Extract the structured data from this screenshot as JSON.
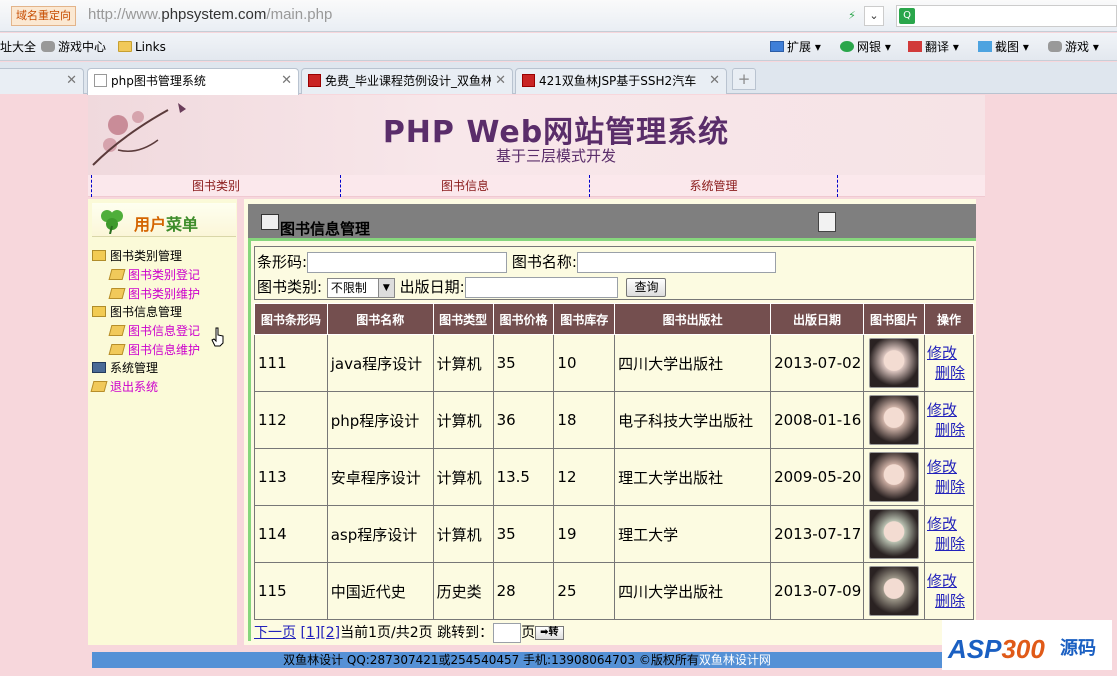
{
  "browser": {
    "redirect_badge": "域名重定向",
    "url_prefix": "http://www.",
    "url_host": "phpsystem.com",
    "url_path": "/main.php"
  },
  "bookmarks": {
    "left": [
      {
        "label": "址大全"
      },
      {
        "label": "游戏中心"
      },
      {
        "label": "Links"
      }
    ],
    "right": [
      {
        "label": "扩展"
      },
      {
        "label": "网银"
      },
      {
        "label": "翻译"
      },
      {
        "label": "截图"
      },
      {
        "label": "游戏"
      }
    ]
  },
  "tabs": [
    {
      "label": "php图书管理系统",
      "active": true
    },
    {
      "label": "免费_毕业课程范例设计_双鱼林",
      "active": false
    },
    {
      "label": "421双鱼林JSP基于SSH2汽车",
      "active": false
    }
  ],
  "banner": {
    "title": "PHP Web网站管理系统",
    "subtitle": "基于三层模式开发"
  },
  "nav": [
    "图书类别",
    "图书信息",
    "系统管理"
  ],
  "sidebar": {
    "title_a": "用户",
    "title_b": "菜单",
    "items": [
      {
        "label": "图书类别管理",
        "type": "folder"
      },
      {
        "label": "图书类别登记",
        "type": "link"
      },
      {
        "label": "图书类别维护",
        "type": "link"
      },
      {
        "label": "图书信息管理",
        "type": "folder"
      },
      {
        "label": "图书信息登记",
        "type": "link"
      },
      {
        "label": "图书信息维护",
        "type": "link"
      },
      {
        "label": "系统管理",
        "type": "system"
      },
      {
        "label": "退出系统",
        "type": "link"
      }
    ]
  },
  "main": {
    "title": "图书信息管理",
    "form": {
      "barcode_label": "条形码:",
      "name_label": "图书名称:",
      "type_label": "图书类别:",
      "type_value": "不限制",
      "date_label": "出版日期:",
      "query_button": "查询"
    },
    "columns": [
      "图书条形码",
      "图书名称",
      "图书类型",
      "图书价格",
      "图书库存",
      "图书出版社",
      "出版日期",
      "图书图片",
      "操作"
    ],
    "rows": [
      {
        "barcode": "111",
        "name": "java程序设计",
        "type": "计算机",
        "price": "35",
        "stock": "10",
        "publisher": "四川大学出版社",
        "date": "2013-07-02",
        "photo_color": "#d9c3bd"
      },
      {
        "barcode": "112",
        "name": "php程序设计",
        "type": "计算机",
        "price": "36",
        "stock": "18",
        "publisher": "电子科技大学出版社",
        "date": "2008-01-16",
        "photo_color": "#cdb1a6"
      },
      {
        "barcode": "113",
        "name": "安卓程序设计",
        "type": "计算机",
        "price": "13.5",
        "stock": "12",
        "publisher": "理工大学出版社",
        "date": "2009-05-20",
        "photo_color": "#c9aba0"
      },
      {
        "barcode": "114",
        "name": "asp程序设计",
        "type": "计算机",
        "price": "35",
        "stock": "19",
        "publisher": "理工大学",
        "date": "2013-07-17",
        "photo_color": "#b8c0b0"
      },
      {
        "barcode": "115",
        "name": "中国近代史",
        "type": "历史类",
        "price": "28",
        "stock": "25",
        "publisher": "四川大学出版社",
        "date": "2013-07-09",
        "photo_color": "#9c9688"
      }
    ],
    "row_actions": {
      "edit": "修改",
      "delete": "删除"
    },
    "pager": {
      "next": "下一页",
      "page1": "[1]",
      "page2": "[2]",
      "status": "当前1页/共2页",
      "jump_label": "跳转到：",
      "page_unit": "页",
      "go_button": "➡转"
    }
  },
  "footer": {
    "text": "双鱼林设计 QQ:287307421或254540457 手机:13908064703 ©版权所有",
    "link": "双鱼林设计网"
  },
  "watermark": {
    "brand_a": "ASP",
    "brand_b": "300",
    "cn": "源码"
  }
}
